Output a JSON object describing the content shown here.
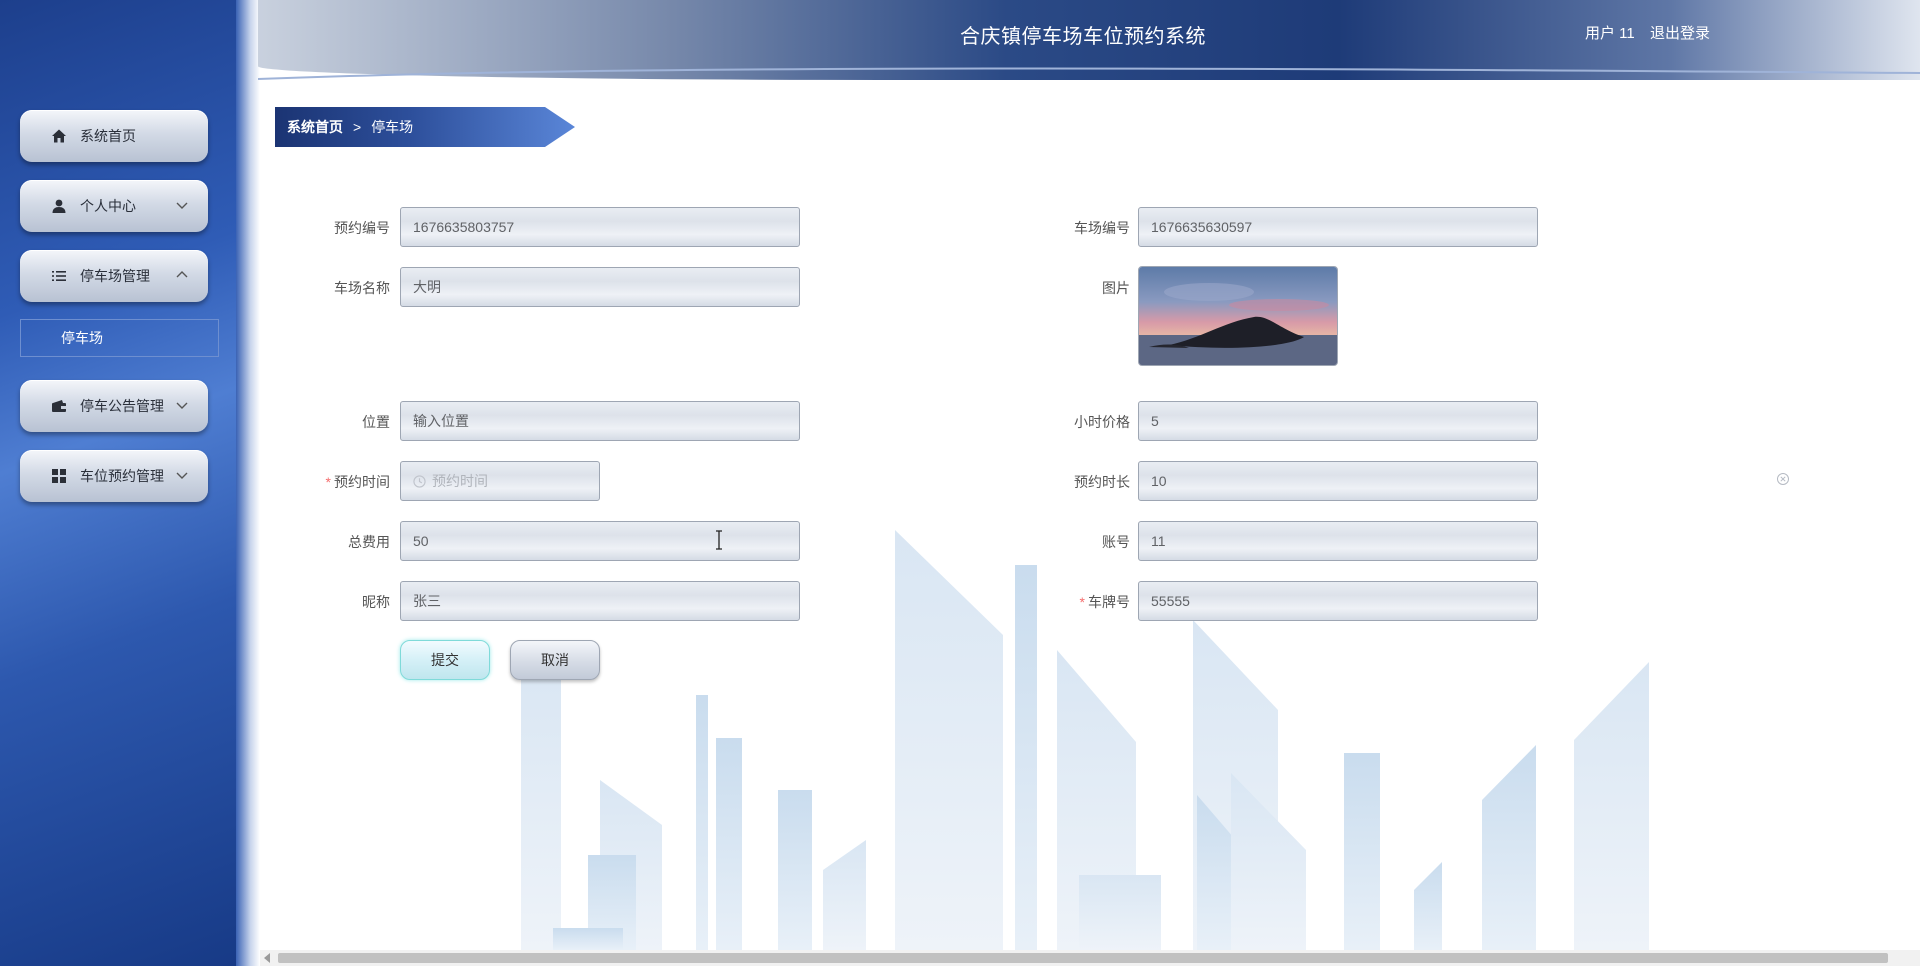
{
  "header": {
    "title": "合庆镇停车场车位预约系统",
    "user": "用户 11",
    "logout": "退出登录"
  },
  "sidebar": {
    "items": [
      {
        "label": "系统首页",
        "icon": "home-icon",
        "expandable": false
      },
      {
        "label": "个人中心",
        "icon": "user-icon",
        "expandable": true,
        "expanded": false
      },
      {
        "label": "停车场管理",
        "icon": "list-icon",
        "expandable": true,
        "expanded": true
      },
      {
        "label": "停车公告管理",
        "icon": "wallet-icon",
        "expandable": true,
        "expanded": false
      },
      {
        "label": "车位预约管理",
        "icon": "grid-icon",
        "expandable": true,
        "expanded": false
      }
    ],
    "submenu": {
      "label": "停车场"
    }
  },
  "breadcrumb": {
    "home": "系统首页",
    "separator": ">",
    "current": "停车场"
  },
  "form": {
    "booking_no": {
      "label": "预约编号",
      "value": "1676635803757"
    },
    "lot_no": {
      "label": "车场编号",
      "value": "1676635630597"
    },
    "lot_name": {
      "label": "车场名称",
      "value": "大明"
    },
    "image": {
      "label": "图片"
    },
    "location": {
      "label": "位置",
      "value": "输入位置"
    },
    "hour_price": {
      "label": "小时价格",
      "value": "5"
    },
    "booking_time": {
      "label": "预约时间",
      "placeholder": "预约时间",
      "required": true
    },
    "booking_duration": {
      "label": "预约时长",
      "value": "10"
    },
    "total_fee": {
      "label": "总费用",
      "value": "50"
    },
    "account": {
      "label": "账号",
      "value": "11"
    },
    "nickname": {
      "label": "昵称",
      "value": "张三"
    },
    "plate_no": {
      "label": "车牌号",
      "value": "55555",
      "required": true
    }
  },
  "buttons": {
    "submit": "提交",
    "cancel": "取消"
  },
  "required_mark": "*"
}
